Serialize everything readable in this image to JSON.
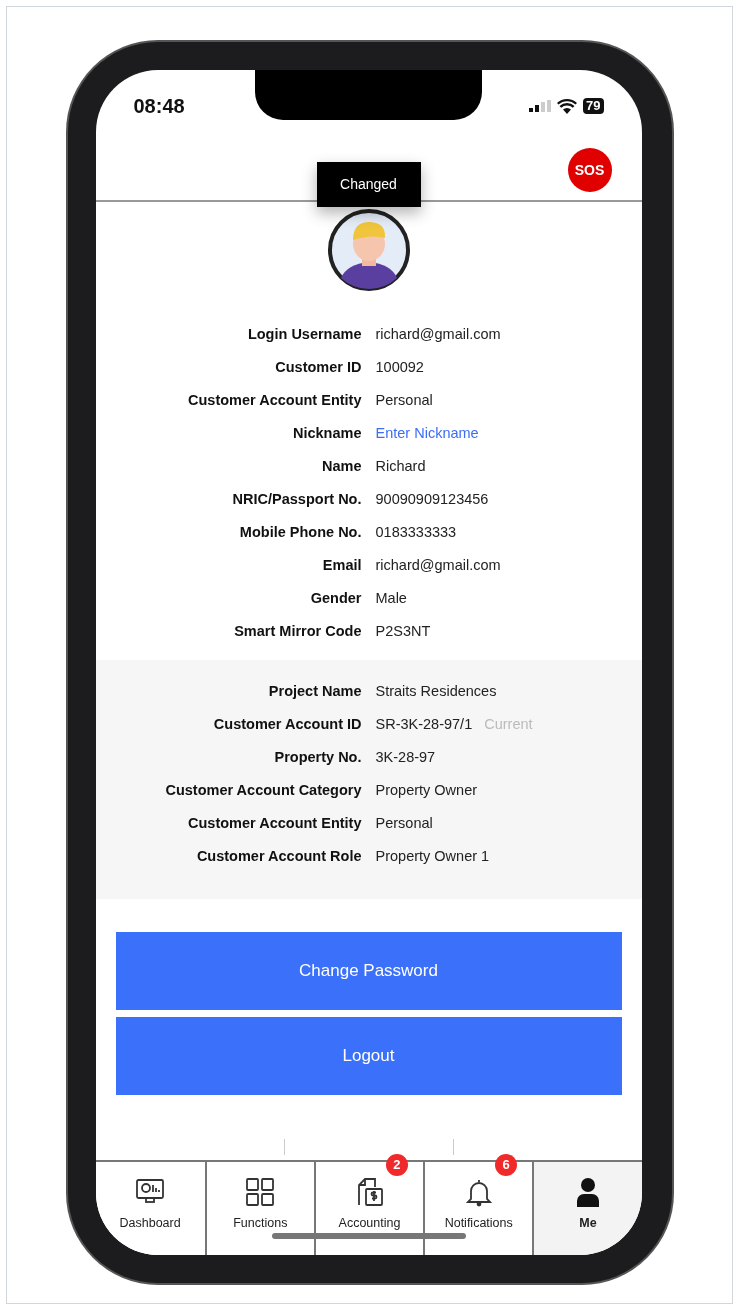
{
  "status_bar": {
    "time": "08:48",
    "battery": "79"
  },
  "header": {
    "sos": "SOS"
  },
  "toast": "Changed",
  "profile": [
    {
      "label": "Login Username",
      "value": "richard@gmail.com",
      "kind": "text"
    },
    {
      "label": "Customer ID",
      "value": "100092",
      "kind": "text"
    },
    {
      "label": "Customer Account Entity",
      "value": "Personal",
      "kind": "text"
    },
    {
      "label": "Nickname",
      "value": "Enter Nickname",
      "kind": "link"
    },
    {
      "label": "Name",
      "value": "Richard",
      "kind": "text"
    },
    {
      "label": "NRIC/Passport No.",
      "value": "90090909123456",
      "kind": "text"
    },
    {
      "label": "Mobile Phone No.",
      "value": "0183333333",
      "kind": "text"
    },
    {
      "label": "Email",
      "value": "richard@gmail.com",
      "kind": "text"
    },
    {
      "label": "Gender",
      "value": "Male",
      "kind": "text"
    },
    {
      "label": "Smart Mirror Code",
      "value": "P2S3NT",
      "kind": "text"
    }
  ],
  "account": [
    {
      "label": "Project Name",
      "value": "Straits Residences"
    },
    {
      "label": "Customer Account ID",
      "value": "SR-3K-28-97/1",
      "tag": "Current"
    },
    {
      "label": "Property No.",
      "value": "3K-28-97"
    },
    {
      "label": "Customer Account Category",
      "value": "Property Owner"
    },
    {
      "label": "Customer Account Entity",
      "value": "Personal"
    },
    {
      "label": "Customer Account Role",
      "value": "Property Owner 1"
    }
  ],
  "buttons": [
    "Change Password",
    "Logout"
  ],
  "tabs": [
    {
      "label": "Dashboard",
      "kind": "dashboard",
      "selected": false
    },
    {
      "label": "Functions",
      "kind": "grid",
      "selected": false
    },
    {
      "label": "Accounting",
      "kind": "accounting",
      "badge": "2",
      "selected": false
    },
    {
      "label": "Notifications",
      "kind": "bell",
      "badge": "6",
      "selected": false
    },
    {
      "label": "Me",
      "kind": "person",
      "selected": true
    }
  ]
}
